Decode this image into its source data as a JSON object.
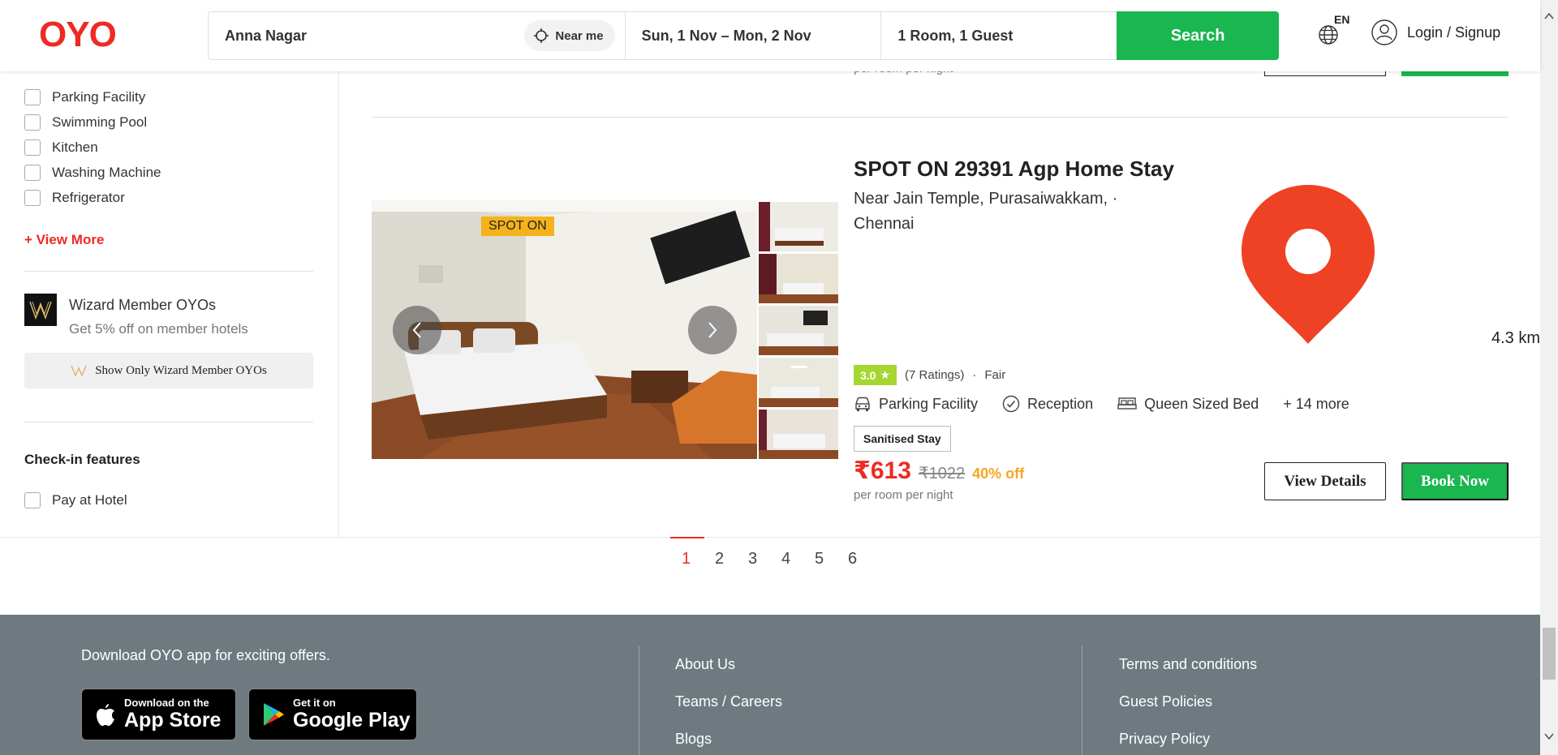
{
  "header": {
    "logo": "OYO",
    "search": {
      "location": "Anna Nagar",
      "near_me": "Near me",
      "dates": "Sun, 1 Nov – Mon, 2 Nov",
      "guests": "1 Room, 1 Guest",
      "search_label": "Search"
    },
    "language": "EN",
    "login": "Login / Signup"
  },
  "sidebar": {
    "amenities": [
      "Parking Facility",
      "Swimming Pool",
      "Kitchen",
      "Washing Machine",
      "Refrigerator"
    ],
    "view_more": "+ View More",
    "wizard": {
      "title": "Wizard Member OYOs",
      "subtitle": "Get 5% off on member hotels",
      "button": "Show Only Wizard Member OYOs"
    },
    "checkin_title": "Check-in features",
    "checkin_items": [
      "Pay at Hotel"
    ]
  },
  "previous_listing": {
    "per_night": "per room per night"
  },
  "listing": {
    "badge": "SPOT ON",
    "name": "SPOT ON 29391 Agp Home Stay",
    "address_line1": "Near Jain Temple, Purasaiwakkam,  ·",
    "address_line2": "Chennai",
    "distance": "4.3 km",
    "rating": "3.0",
    "ratings_count": "(7 Ratings)",
    "rating_sep": "·",
    "rating_label": "Fair",
    "amenities": [
      "Parking Facility",
      "Reception",
      "Queen Sized Bed"
    ],
    "more_amenities": "+ 14 more",
    "sanitised": "Sanitised Stay",
    "price": "₹613",
    "old_price": "₹1022",
    "discount": "40% off",
    "per_night": "per room per night",
    "view_details": "View Details",
    "book_now": "Book Now"
  },
  "pagination": {
    "pages": [
      "1",
      "2",
      "3",
      "4",
      "5",
      "6"
    ],
    "current": "1"
  },
  "footer": {
    "download_text": "Download OYO app for exciting offers.",
    "app_store_small": "Download on the",
    "app_store_big": "App Store",
    "google_small": "Get it on",
    "google_big": "Google Play",
    "col1": [
      "About Us",
      "Teams / Careers",
      "Blogs"
    ],
    "col2": [
      "Terms and conditions",
      "Guest Policies",
      "Privacy Policy"
    ]
  },
  "colors": {
    "brand_red": "#ee2a24",
    "green": "#1ab64f",
    "rating_green": "#a5d631",
    "discount_orange": "#f5a623",
    "footer_bg": "#6e7a80"
  }
}
